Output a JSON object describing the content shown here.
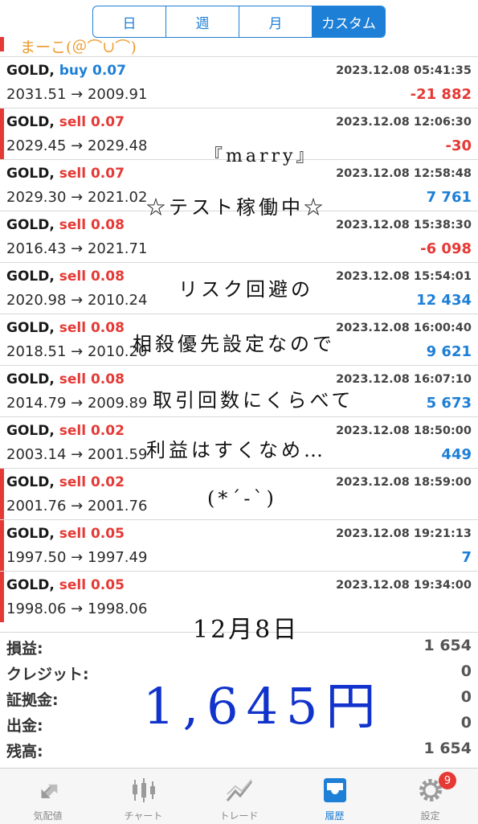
{
  "period_tabs": [
    {
      "label": "日",
      "active": false
    },
    {
      "label": "週",
      "active": false
    },
    {
      "label": "月",
      "active": false
    },
    {
      "label": "カスタム",
      "active": true
    }
  ],
  "handwriting": {
    "top_scribble": "まーこ(＠⌒∪⌒)",
    "lines": [
      "『marry』",
      "☆テスト稼働中☆",
      "リスク回避の",
      "相殺優先設定なので",
      "取引回数にくらべて",
      "利益はすくなめ…",
      "(*´-`)"
    ],
    "date": "12月8日",
    "amount": "1,645円"
  },
  "trades": [
    {
      "symbol": "GOLD,",
      "side": "buy",
      "lots": "0.07",
      "prices": "2031.51 → 2009.91",
      "time": "2023.12.08 05:41:35",
      "profit": "-21 882",
      "sign": "neg",
      "marked": false
    },
    {
      "symbol": "GOLD,",
      "side": "sell",
      "lots": "0.07",
      "prices": "2029.45 → 2029.48",
      "time": "2023.12.08 12:06:30",
      "profit": "-30",
      "sign": "neg",
      "marked": true
    },
    {
      "symbol": "GOLD,",
      "side": "sell",
      "lots": "0.07",
      "prices": "2029.30 → 2021.02",
      "time": "2023.12.08 12:58:48",
      "profit": "7 761",
      "sign": "pos",
      "marked": false
    },
    {
      "symbol": "GOLD,",
      "side": "sell",
      "lots": "0.08",
      "prices": "2016.43 → 2021.71",
      "time": "2023.12.08 15:38:30",
      "profit": "-6 098",
      "sign": "neg",
      "marked": false
    },
    {
      "symbol": "GOLD,",
      "side": "sell",
      "lots": "0.08",
      "prices": "2020.98 → 2010.24",
      "time": "2023.12.08 15:54:01",
      "profit": "12 434",
      "sign": "pos",
      "marked": false
    },
    {
      "symbol": "GOLD,",
      "side": "sell",
      "lots": "0.08",
      "prices": "2018.51 → 2010.20",
      "time": "2023.12.08 16:00:40",
      "profit": "9 621",
      "sign": "pos",
      "marked": false
    },
    {
      "symbol": "GOLD,",
      "side": "sell",
      "lots": "0.08",
      "prices": "2014.79 → 2009.89",
      "time": "2023.12.08 16:07:10",
      "profit": "5 673",
      "sign": "pos",
      "marked": false
    },
    {
      "symbol": "GOLD,",
      "side": "sell",
      "lots": "0.02",
      "prices": "2003.14 → 2001.59",
      "time": "2023.12.08 18:50:00",
      "profit": "449",
      "sign": "pos",
      "marked": false
    },
    {
      "symbol": "GOLD,",
      "side": "sell",
      "lots": "0.02",
      "prices": "2001.76 → 2001.76",
      "time": "2023.12.08 18:59:00",
      "profit": "",
      "sign": "zero",
      "marked": true
    },
    {
      "symbol": "GOLD,",
      "side": "sell",
      "lots": "0.05",
      "prices": "1997.50 → 1997.49",
      "time": "2023.12.08 19:21:13",
      "profit": "7",
      "sign": "pos",
      "marked": true
    },
    {
      "symbol": "GOLD,",
      "side": "sell",
      "lots": "0.05",
      "prices": "1998.06 → 1998.06",
      "time": "2023.12.08 19:34:00",
      "profit": "",
      "sign": "zero",
      "marked": true
    }
  ],
  "summary": [
    {
      "label": "損益:",
      "value": "1 654"
    },
    {
      "label": "クレジット:",
      "value": "0"
    },
    {
      "label": "証拠金:",
      "value": "0"
    },
    {
      "label": "出金:",
      "value": "0"
    },
    {
      "label": "残高:",
      "value": "1 654"
    }
  ],
  "nav": {
    "items": [
      {
        "label": "気配値",
        "icon": "quotes-icon",
        "active": false
      },
      {
        "label": "チャート",
        "icon": "chart-icon",
        "active": false
      },
      {
        "label": "トレード",
        "icon": "trade-icon",
        "active": false
      },
      {
        "label": "履歴",
        "icon": "history-icon",
        "active": true
      },
      {
        "label": "設定",
        "icon": "gear-icon",
        "active": false
      }
    ],
    "badge": "9"
  },
  "colors": {
    "accent": "#1e7fd6",
    "loss": "#e53935",
    "handwriting_amount": "#1133cc",
    "scribble": "#ee9a2a"
  }
}
